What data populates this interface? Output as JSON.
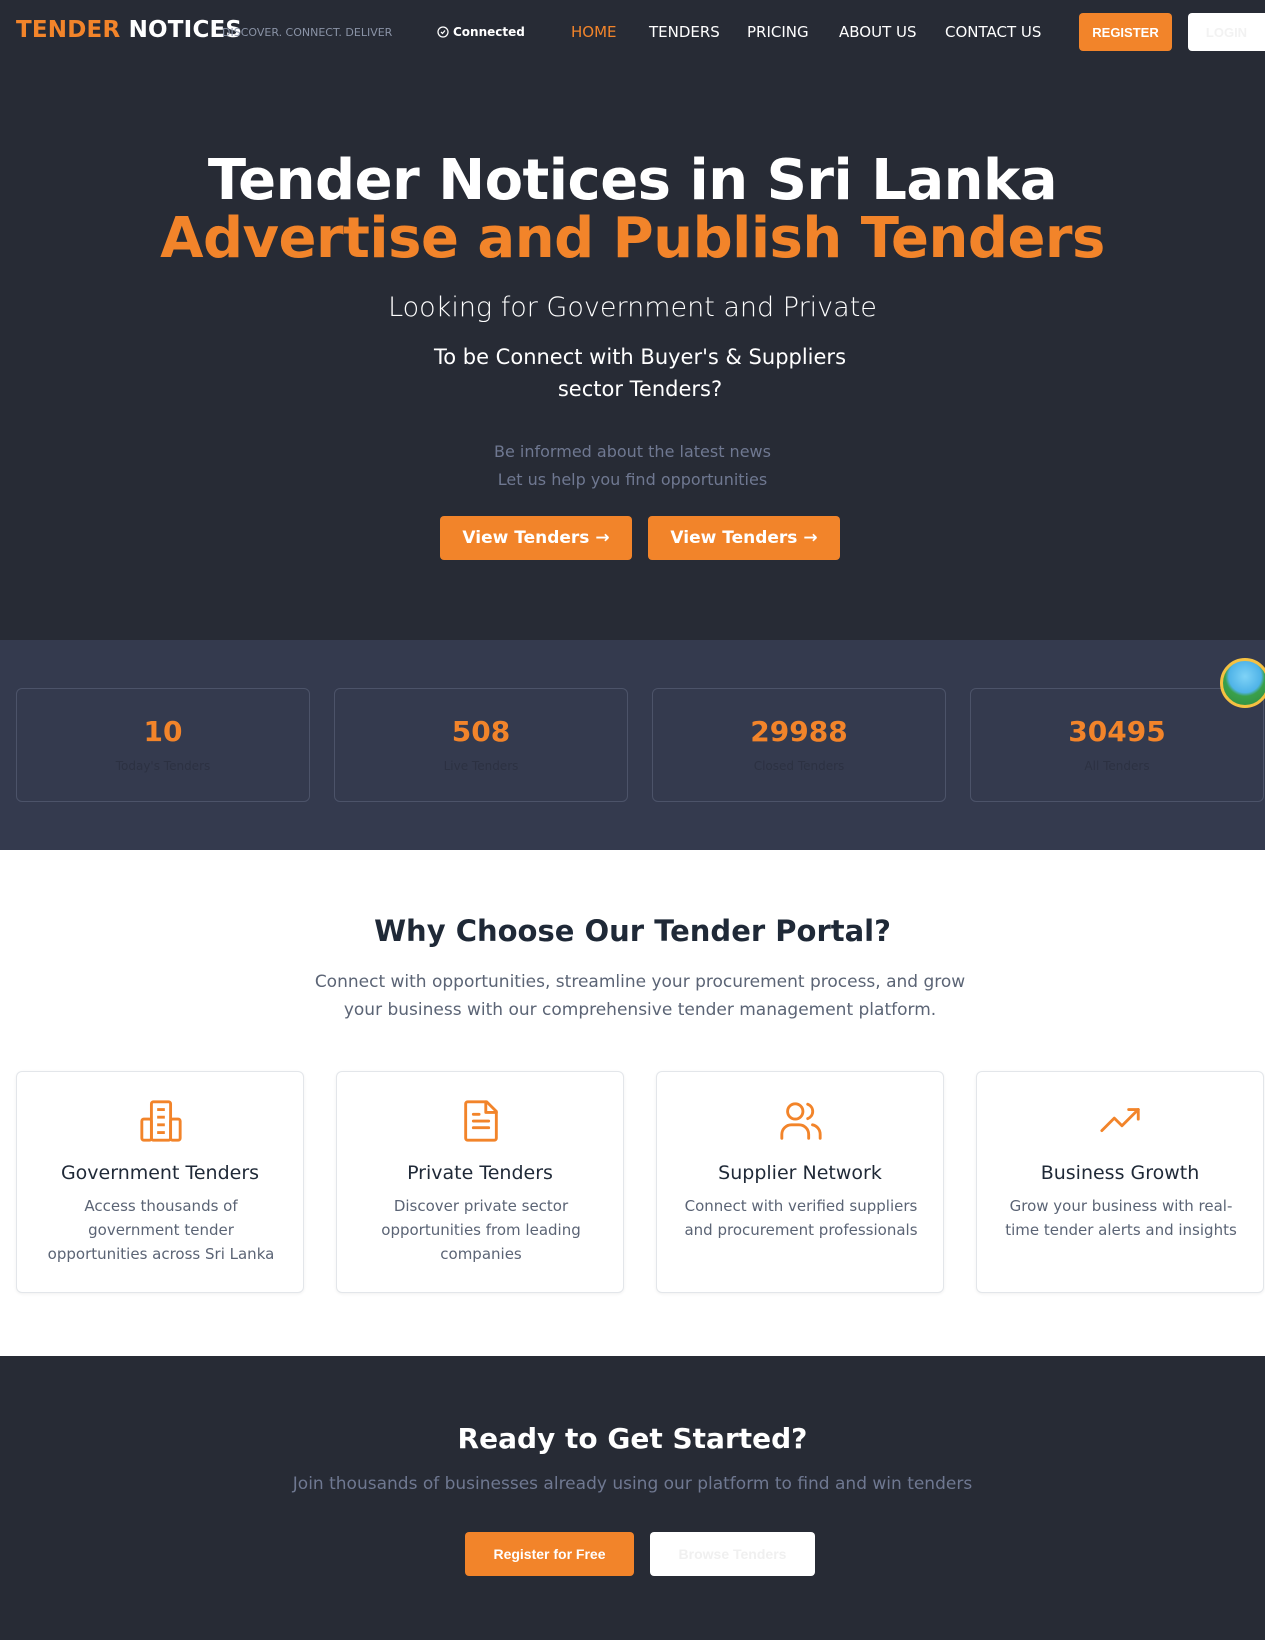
{
  "nav": {
    "brand_part1": "TENDER",
    "brand_part2": "NOTICES",
    "tagline": "DISCOVER. CONNECT. DELIVER",
    "status": "Connected",
    "links": [
      "HOME",
      "TENDERS",
      "PRICING",
      "ABOUT US",
      "CONTACT US"
    ],
    "active_link": "HOME",
    "register_label": "REGISTER",
    "login_label": "LOGIN"
  },
  "hero": {
    "title_line1": "Tender Notices in Sri Lanka",
    "title_line2": "Advertise and Publish Tenders",
    "subtitle1": "Looking for Government and Private",
    "subtitle2": "To be Connect with Buyer's & Suppliers sector Tenders?",
    "info_line1": "Be informed about the latest news",
    "info_line2": "Let us help you find opportunities",
    "button1_label": "View Tenders →",
    "button2_label": "View Tenders →"
  },
  "stats": [
    {
      "value": "10",
      "label": "Today's Tenders"
    },
    {
      "value": "508",
      "label": "Live Tenders"
    },
    {
      "value": "29988",
      "label": "Closed Tenders"
    },
    {
      "value": "30495",
      "label": "All Tenders"
    }
  ],
  "why": {
    "title": "Why Choose Our Tender Portal?",
    "description": "Connect with opportunities, streamline your procurement process, and grow your business with our comprehensive tender management platform.",
    "cards": [
      {
        "icon": "building-icon",
        "title": "Government Tenders",
        "description": "Access thousands of government tender opportunities across Sri Lanka"
      },
      {
        "icon": "document-icon",
        "title": "Private Tenders",
        "description": "Discover private sector opportunities from leading companies"
      },
      {
        "icon": "users-icon",
        "title": "Supplier Network",
        "description": "Connect with verified suppliers and procurement professionals"
      },
      {
        "icon": "trending-up-icon",
        "title": "Business Growth",
        "description": "Grow your business with real-time tender alerts and insights"
      }
    ]
  },
  "cta": {
    "title": "Ready to Get Started?",
    "description": "Join thousands of businesses already using our platform to find and win tenders",
    "button1_label": "Register for Free",
    "button2_label": "Browse Tenders"
  },
  "colors": {
    "accent": "#f2842a",
    "dark_bg": "#272b35",
    "stats_bg": "#343a4e"
  }
}
